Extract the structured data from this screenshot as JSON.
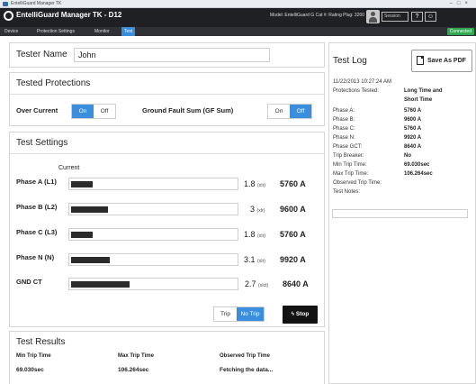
{
  "window": {
    "title": "EntelliGuard Manager TK"
  },
  "app": {
    "title": "EntelliGuard Manager TK - D12",
    "model_info": "Model: EntelliGuard G  Cat #:   Rating Plug: 3200",
    "user": "Session",
    "controls": [
      "?",
      "☺"
    ]
  },
  "nav": {
    "tabs": [
      "Device",
      "Protection Settings",
      "Monitor",
      "Test"
    ],
    "active_tab": "Test",
    "status": "Connected"
  },
  "tester": {
    "label": "Tester Name",
    "value": "John"
  },
  "protections": {
    "title": "Tested Protections",
    "over_current": {
      "label": "Over Current",
      "on": "On",
      "off": "Off",
      "selected": "On"
    },
    "ground_fault": {
      "label": "Ground Fault Sum (GF Sum)",
      "on": "On",
      "off": "Off",
      "selected": "Off"
    }
  },
  "settings": {
    "title": "Test Settings",
    "column": "Current",
    "phases": [
      {
        "label": "Phase A (L1)",
        "ratio": "1.8",
        "unit": "(xIr)",
        "amps": "5760 A",
        "fill": 0.13
      },
      {
        "label": "Phase B (L2)",
        "ratio": "3",
        "unit": "(xIr)",
        "amps": "9600 A",
        "fill": 0.22
      },
      {
        "label": "Phase C (L3)",
        "ratio": "1.8",
        "unit": "(xIr)",
        "amps": "5760 A",
        "fill": 0.13
      },
      {
        "label": "Phase N (N)",
        "ratio": "3.1",
        "unit": "(xIr)",
        "amps": "9920 A",
        "fill": 0.23
      },
      {
        "label": "GND CT",
        "ratio": "2.7",
        "unit": "(xIct)",
        "amps": "8640 A",
        "fill": 0.35
      }
    ],
    "mode": {
      "trip": "Trip",
      "no_trip": "No Trip",
      "selected": "No Trip"
    },
    "stop_label": "Stop"
  },
  "results": {
    "title": "Test Results",
    "columns": [
      "Min Trip Time",
      "Max Trip Time",
      "Observed Trip Time"
    ],
    "values": [
      "69.030sec",
      "106.264sec",
      "Fetching the data..."
    ]
  },
  "log": {
    "title": "Test Log",
    "save_label": "Save As PDF",
    "timestamp": "11/22/2013 10:27:24 AM",
    "protections_key": "Protections Tested:",
    "protections_value": [
      "Long Time and",
      "Short Time"
    ],
    "rows": [
      {
        "key": "Phase A:",
        "value": "5760 A"
      },
      {
        "key": "Phase B:",
        "value": "9600 A"
      },
      {
        "key": "Phase C:",
        "value": "5760 A"
      },
      {
        "key": "Phase N:",
        "value": "9920 A"
      },
      {
        "key": "Phase GCT:",
        "value": "8640 A"
      },
      {
        "key": "Trip Breaker:",
        "value": "No"
      },
      {
        "key": "Min Trip Time:",
        "value": "69.030sec"
      },
      {
        "key": "Max Trip Time:",
        "value": "106.264sec"
      },
      {
        "key": "Observed Trip Time:",
        "value": ""
      }
    ],
    "notes_label": "Test Notes:"
  },
  "colors": {
    "accent": "#3b8ede",
    "appbar": "#1f2024",
    "status": "#2fa84f"
  }
}
